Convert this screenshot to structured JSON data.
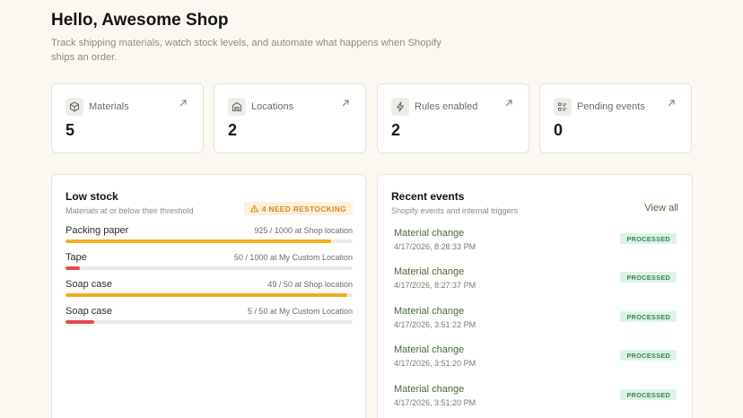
{
  "header": {
    "title": "Hello, Awesome Shop",
    "subtitle": "Track shipping materials, watch stock levels, and automate what happens when Shopify ships an order."
  },
  "stats": [
    {
      "label": "Materials",
      "value": "5",
      "icon": "box-icon"
    },
    {
      "label": "Locations",
      "value": "2",
      "icon": "warehouse-icon"
    },
    {
      "label": "Rules enabled",
      "value": "2",
      "icon": "lightning-icon"
    },
    {
      "label": "Pending events",
      "value": "0",
      "icon": "list-icon"
    }
  ],
  "low_stock": {
    "title": "Low stock",
    "subtitle": "Materials at or below their threshold",
    "badge": "4 NEED RESTOCKING",
    "items": [
      {
        "name": "Packing paper",
        "detail": "925 / 1000 at Shop location",
        "level": 0.925,
        "color": "#f0ae1c"
      },
      {
        "name": "Tape",
        "detail": "50 / 1000 at My Custom Location",
        "level": 0.05,
        "color": "#e5494a"
      },
      {
        "name": "Soap case",
        "detail": "49 / 50 at Shop location",
        "level": 0.98,
        "color": "#f0ae1c"
      },
      {
        "name": "Soap case",
        "detail": "5 / 50 at My Custom Location",
        "level": 0.1,
        "color": "#e5494a"
      }
    ]
  },
  "recent_events": {
    "title": "Recent events",
    "subtitle": "Shopify events and internal triggers",
    "view_all": "View all",
    "items": [
      {
        "name": "Material change",
        "time": "4/17/2026, 8:28:33 PM",
        "status": "PROCESSED"
      },
      {
        "name": "Material change",
        "time": "4/17/2026, 8:27:37 PM",
        "status": "PROCESSED"
      },
      {
        "name": "Material change",
        "time": "4/17/2026, 3:51:22 PM",
        "status": "PROCESSED"
      },
      {
        "name": "Material change",
        "time": "4/17/2026, 3:51:20 PM",
        "status": "PROCESSED"
      },
      {
        "name": "Material change",
        "time": "4/17/2026, 3:51:20 PM",
        "status": "PROCESSED"
      }
    ]
  },
  "colors": {
    "background": "#fbf8f1",
    "accent_green": "#4a6a33",
    "warning": "#f0ae1c",
    "danger": "#e5494a",
    "success_badge": "#2f8a56"
  }
}
